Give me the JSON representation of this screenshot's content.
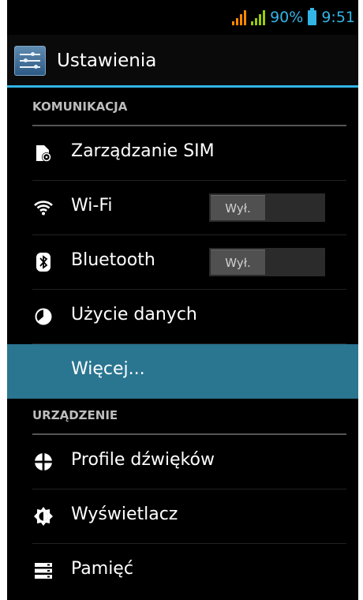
{
  "status_bar": {
    "battery_percent": "90%",
    "time": "9:51"
  },
  "action_bar": {
    "title": "Ustawienia"
  },
  "sections": [
    {
      "header": "KOMUNIKACJA",
      "items": [
        {
          "label": "Zarządzanie SIM",
          "icon": "sim-card-icon"
        },
        {
          "label": "Wi-Fi",
          "icon": "wifi-icon",
          "toggle": "Wył."
        },
        {
          "label": "Bluetooth",
          "icon": "bluetooth-icon",
          "toggle": "Wył."
        },
        {
          "label": "Użycie danych",
          "icon": "data-usage-icon"
        },
        {
          "label": "Więcej...",
          "selected": true
        }
      ]
    },
    {
      "header": "URZĄDZENIE",
      "items": [
        {
          "label": "Profile dźwięków",
          "icon": "sound-profile-icon"
        },
        {
          "label": "Wyświetlacz",
          "icon": "display-icon"
        },
        {
          "label": "Pamięć",
          "icon": "storage-icon"
        }
      ]
    }
  ],
  "colors": {
    "accent": "#33b5e5",
    "selected_row": "#2a7590",
    "background": "#000000"
  }
}
